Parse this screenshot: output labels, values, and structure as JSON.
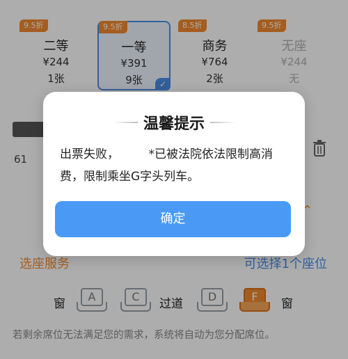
{
  "seat_classes": [
    {
      "discount": "9.5折",
      "name": "二等",
      "price": "¥244",
      "count": "1张"
    },
    {
      "discount": "9.5折",
      "name": "一等",
      "price": "¥391",
      "count": "9张"
    },
    {
      "discount": "8.5折",
      "name": "商务",
      "price": "¥764",
      "count": "2张"
    },
    {
      "discount": "9.5折",
      "name": "无座",
      "price": "¥244",
      "count": "无"
    }
  ],
  "selected_class_index": 1,
  "passenger": {
    "id_partial": "61"
  },
  "seat_service": {
    "title": "选座服务",
    "available": "可选择1个座位"
  },
  "seat_picker": {
    "window_left": "窗",
    "window_right": "窗",
    "aisle": "过道",
    "seats": [
      "A",
      "C",
      "D",
      "F"
    ],
    "selected_seat": "F",
    "hint": "若剩余席位无法满足您的需求，系统将自动为您分配席位。"
  },
  "dialog": {
    "title": "温馨提示",
    "message": "出票失败，　　　*已被法院依法限制高消费，限制乘坐G字头列车。",
    "confirm": "确定"
  },
  "colors": {
    "accent_orange": "#f28a2e",
    "accent_blue": "#4a9af5"
  }
}
